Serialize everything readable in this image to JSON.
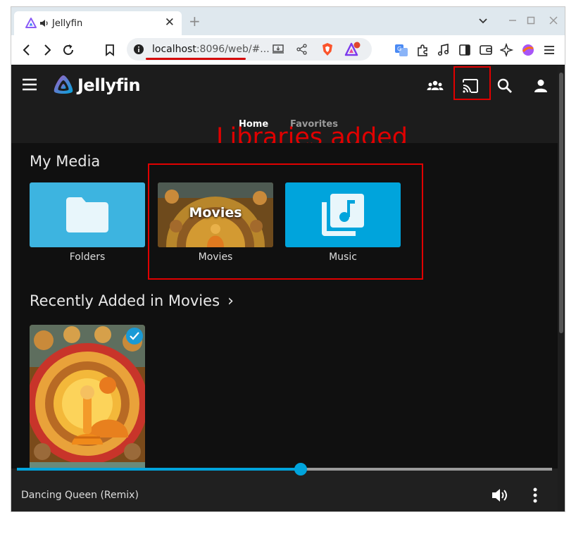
{
  "browser": {
    "tab_title": "Jellyfin",
    "tab_close": "✕",
    "new_tab": "+",
    "url_host": "localhost",
    "url_rest": ":8096/web/#..."
  },
  "app": {
    "title": "Jellyfin",
    "nav_tabs": [
      {
        "label": "Home",
        "active": true
      },
      {
        "label": "Favorites",
        "active": false
      }
    ]
  },
  "annotation": {
    "text": "Libraries added",
    "color": "#e00000"
  },
  "my_media": {
    "title": "My Media",
    "libraries": [
      {
        "label": "Folders",
        "icon": "folder-icon",
        "color": "#3db4e0"
      },
      {
        "label": "Movies",
        "overlay": "Movies",
        "icon": "movies-thumbnail"
      },
      {
        "label": "Music",
        "icon": "music-library-icon",
        "color": "#00a4dc"
      }
    ]
  },
  "recent": {
    "title": "Recently Added in Movies",
    "chevron": "›"
  },
  "now_playing": {
    "title": "Dancing Queen (Remix)",
    "progress": 0.53
  },
  "colors": {
    "accent": "#00a4dc",
    "background": "#101010",
    "header": "#1c1c1c"
  }
}
